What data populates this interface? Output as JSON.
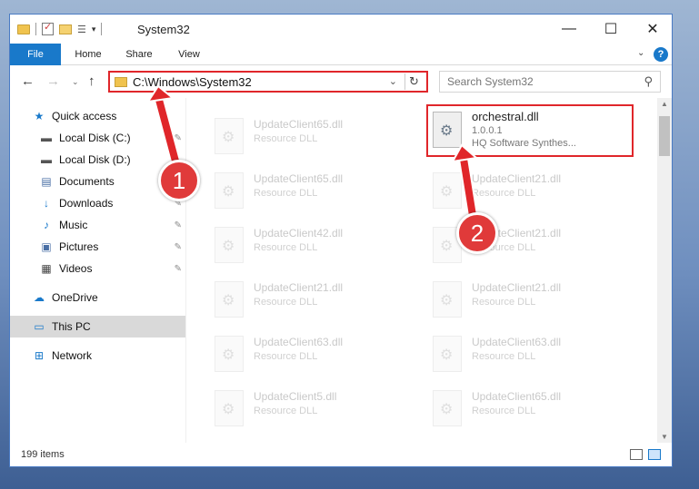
{
  "window": {
    "title": "System32",
    "minimize_glyph": "—",
    "maximize_glyph": "☐",
    "close_glyph": "✕"
  },
  "quick_access_toolbar": {
    "list_glyph": "☰",
    "dropdown_glyph": "▾"
  },
  "ribbon": {
    "tabs": [
      "File",
      "Home",
      "Share",
      "View"
    ],
    "help_glyph": "?",
    "collapse_glyph": "⌄"
  },
  "navigation": {
    "back_glyph": "←",
    "forward_glyph": "→",
    "recent_glyph": "⌄",
    "up_glyph": "↑",
    "address": "C:\\Windows\\System32",
    "address_dropdown_glyph": "⌄",
    "refresh_glyph": "↻",
    "search_placeholder": "Search System32",
    "search_glyph": "⚲"
  },
  "sidebar": {
    "items": [
      {
        "label": "Quick access",
        "icon": "star-icon",
        "glyph": "★",
        "color": "#1979ca",
        "pinned": false
      },
      {
        "label": "Local Disk (C:)",
        "icon": "drive-icon",
        "glyph": "▬",
        "color": "#555555",
        "pinned": true
      },
      {
        "label": "Local Disk (D:)",
        "icon": "drive-icon",
        "glyph": "▬",
        "color": "#555555",
        "pinned": true
      },
      {
        "label": "Documents",
        "icon": "documents-icon",
        "glyph": "▤",
        "color": "#4a6fa5",
        "pinned": true
      },
      {
        "label": "Downloads",
        "icon": "download-icon",
        "glyph": "↓",
        "color": "#1979ca",
        "pinned": true
      },
      {
        "label": "Music",
        "icon": "music-icon",
        "glyph": "♪",
        "color": "#1979ca",
        "pinned": true
      },
      {
        "label": "Pictures",
        "icon": "pictures-icon",
        "glyph": "▣",
        "color": "#4a6fa5",
        "pinned": true
      },
      {
        "label": "Videos",
        "icon": "videos-icon",
        "glyph": "▦",
        "color": "#444444",
        "pinned": true
      },
      {
        "label": "OneDrive",
        "icon": "cloud-icon",
        "glyph": "☁",
        "color": "#1979ca",
        "pinned": false
      },
      {
        "label": "This PC",
        "icon": "computer-icon",
        "glyph": "▭",
        "color": "#1979ca",
        "pinned": false,
        "selected": true
      },
      {
        "label": "Network",
        "icon": "network-icon",
        "glyph": "⊞",
        "color": "#1979ca",
        "pinned": false
      }
    ],
    "pin_glyph": "✎"
  },
  "files": {
    "left_column": [
      {
        "name": "UpdateClient65.dll",
        "type": "Resource DLL"
      },
      {
        "name": "UpdateClient65.dll",
        "type": "Resource DLL"
      },
      {
        "name": "UpdateClient42.dll",
        "type": "Resource DLL"
      },
      {
        "name": "UpdateClient21.dll",
        "type": "Resource DLL"
      },
      {
        "name": "UpdateClient63.dll",
        "type": "Resource DLL"
      },
      {
        "name": "UpdateClient5.dll",
        "type": "Resource DLL"
      }
    ],
    "right_column": [
      {
        "name": "orchestral.dll",
        "version": "1.0.0.1",
        "company": "HQ Software Synthes...",
        "highlighted": true
      },
      {
        "name": "UpdateClient21.dll",
        "type": "Resource DLL"
      },
      {
        "name": "UpdateClient21.dll",
        "type": "Resource DLL"
      },
      {
        "name": "UpdateClient21.dll",
        "type": "Resource DLL"
      },
      {
        "name": "UpdateClient63.dll",
        "type": "Resource DLL"
      },
      {
        "name": "UpdateClient65.dll",
        "type": "Resource DLL"
      }
    ]
  },
  "status_bar": {
    "item_count": "199 items"
  },
  "annotations": {
    "badge_1": "1",
    "badge_2": "2",
    "color": "#e0262a"
  },
  "scrollbar": {
    "up_glyph": "▲",
    "down_glyph": "▼"
  }
}
